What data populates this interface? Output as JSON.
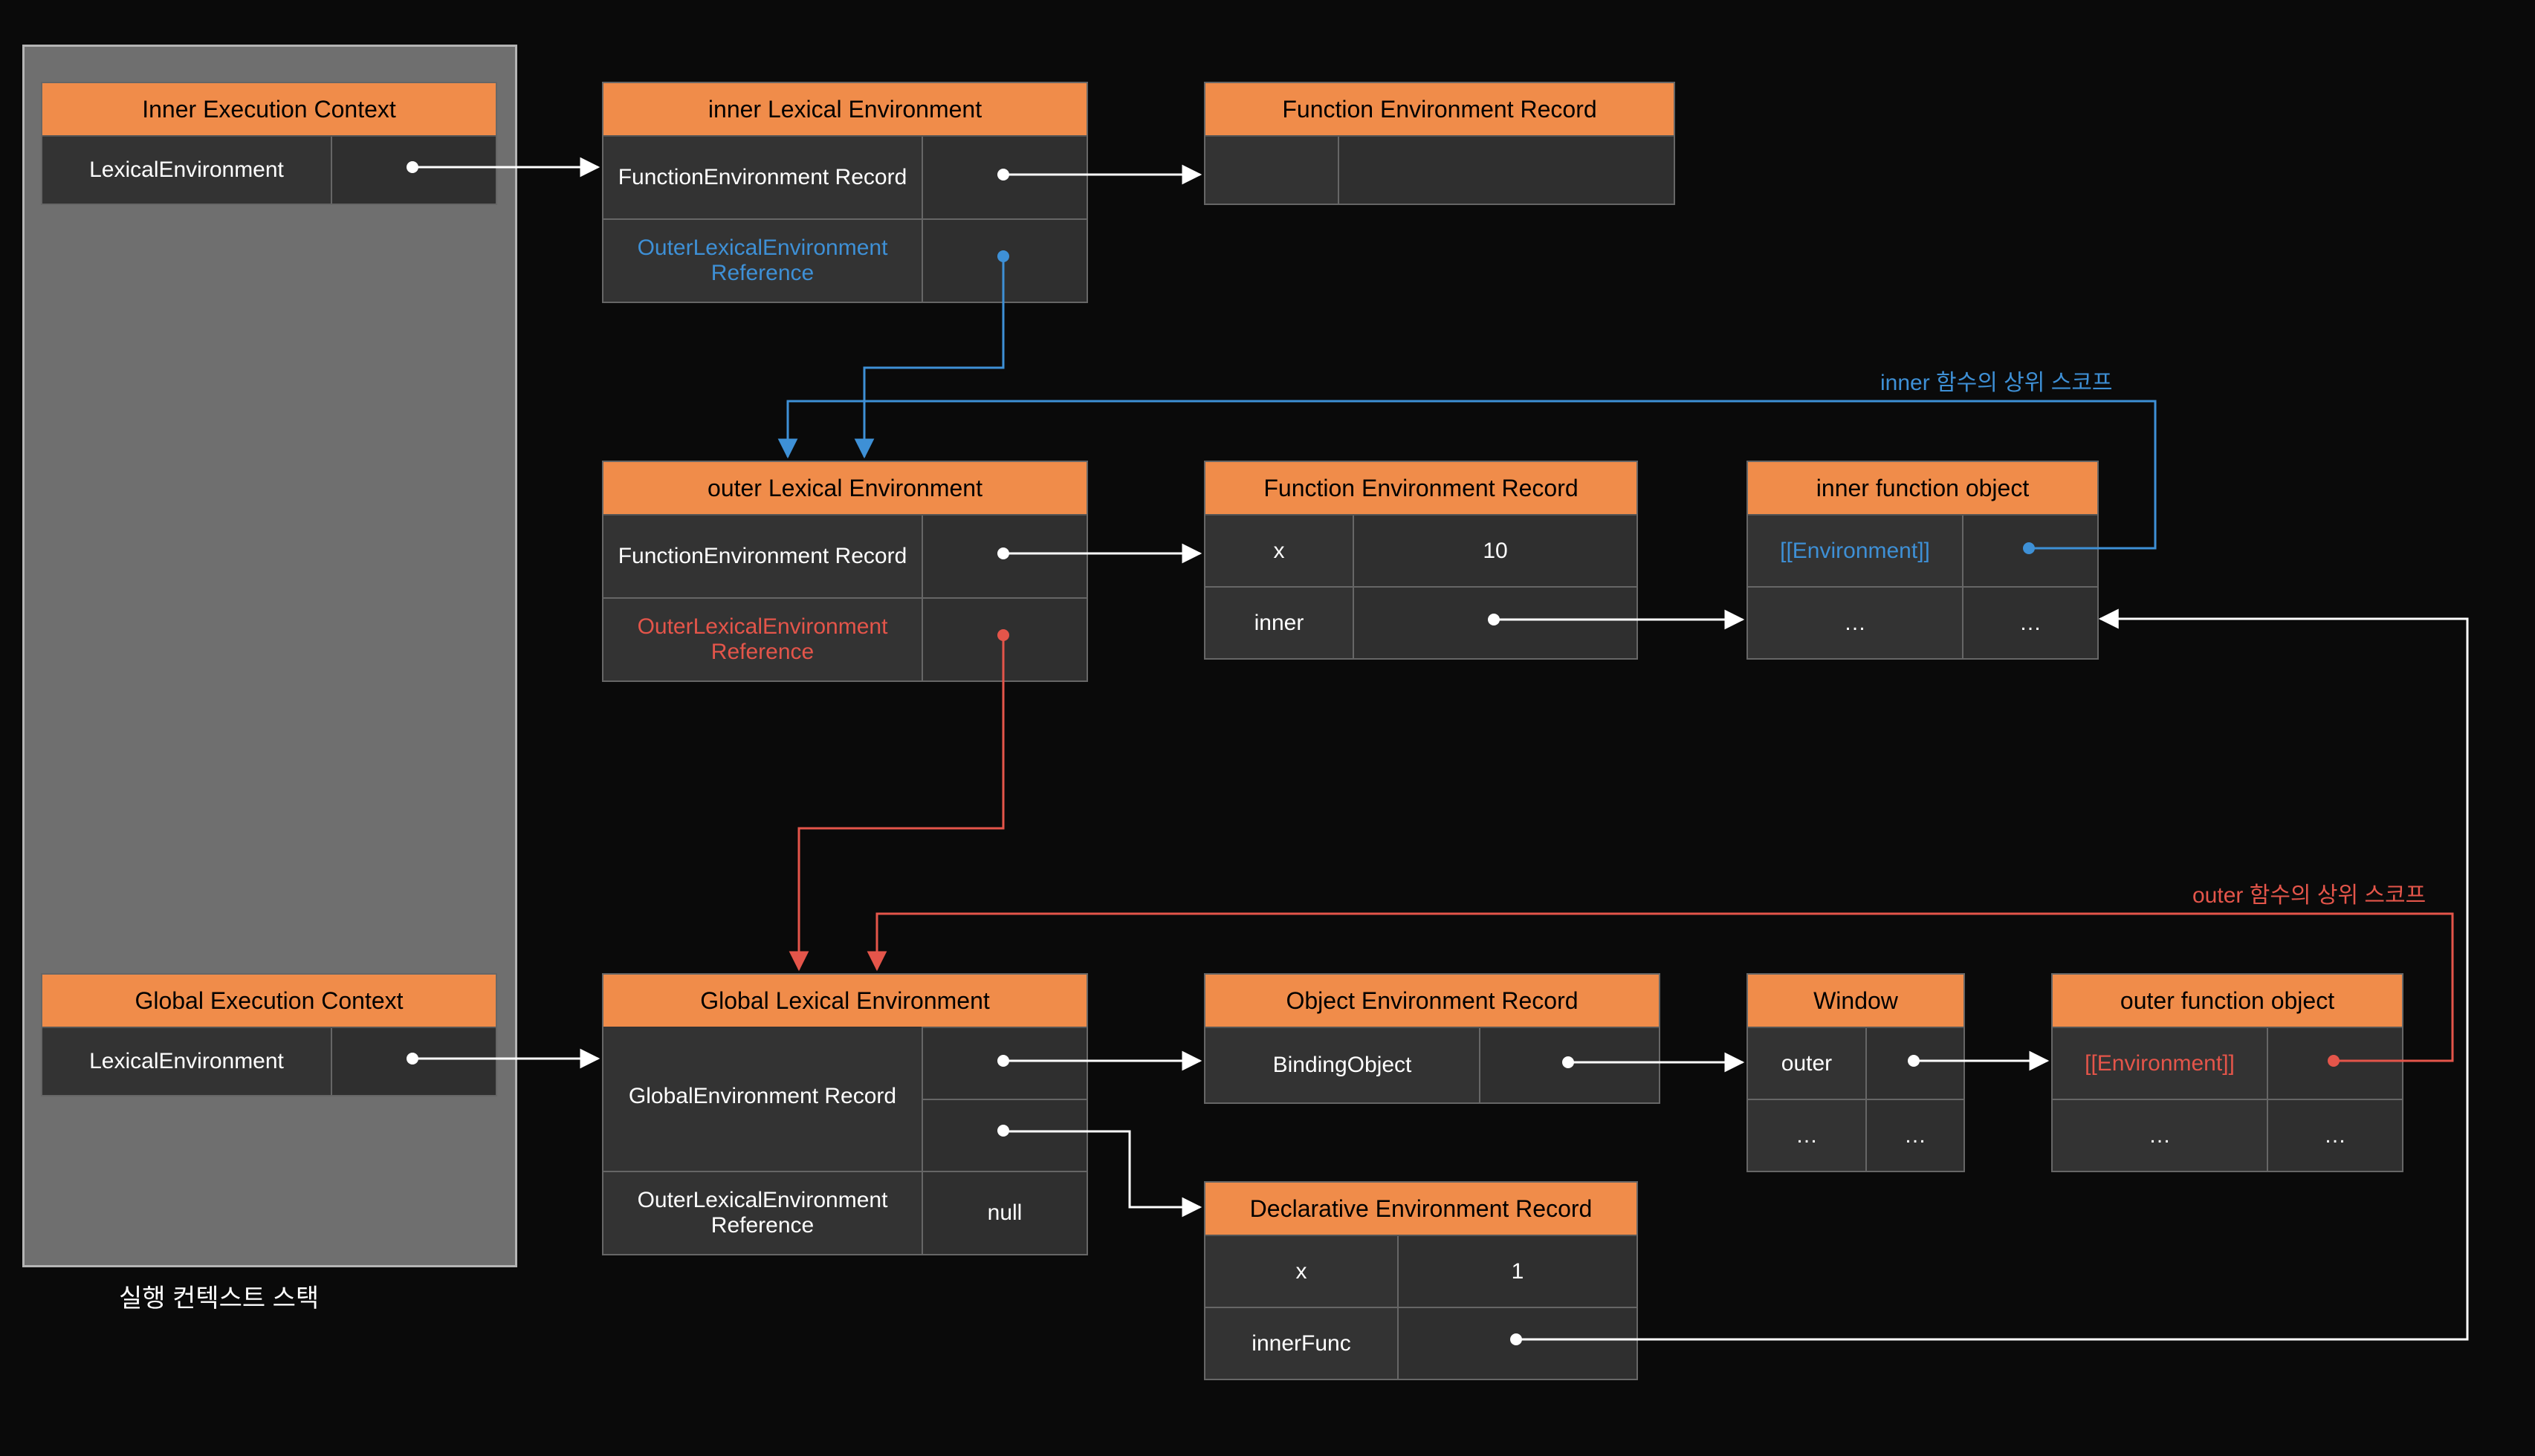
{
  "stack": {
    "label": "실행 컨텍스트 스택",
    "inner_ctx_title": "Inner Execution Context",
    "inner_ctx_row": "LexicalEnvironment",
    "global_ctx_title": "Global Execution Context",
    "global_ctx_row": "LexicalEnvironment"
  },
  "inner_lex": {
    "title": "inner Lexical Environment",
    "row1": "FunctionEnvironment Record",
    "row2": "OuterLexicalEnvironment Reference"
  },
  "inner_fer": {
    "title": "Function Environment Record"
  },
  "outer_lex": {
    "title": "outer Lexical Environment",
    "row1": "FunctionEnvironment Record",
    "row2": "OuterLexicalEnvironment Reference"
  },
  "outer_fer": {
    "title": "Function Environment Record",
    "x_label": "x",
    "x_value": "10",
    "inner_label": "inner"
  },
  "inner_fn": {
    "title": "inner function object",
    "env": "[[Environment]]",
    "dots": "…"
  },
  "global_lex": {
    "title": "Global Lexical Environment",
    "row1": "GlobalEnvironment Record",
    "row2": "OuterLexicalEnvironment Reference",
    "null": "null"
  },
  "obj_er": {
    "title": "Object Environment Record",
    "binding": "BindingObject"
  },
  "window": {
    "title": "Window",
    "outer": "outer",
    "dots": "…"
  },
  "outer_fn": {
    "title": "outer function object",
    "env": "[[Environment]]",
    "dots": "…"
  },
  "decl_er": {
    "title": "Declarative Environment Record",
    "x_label": "x",
    "x_value": "1",
    "innerFunc": "innerFunc"
  },
  "legend": {
    "inner_scope": "inner 함수의 상위 스코프",
    "outer_scope": "outer 함수의 상위 스코프"
  }
}
